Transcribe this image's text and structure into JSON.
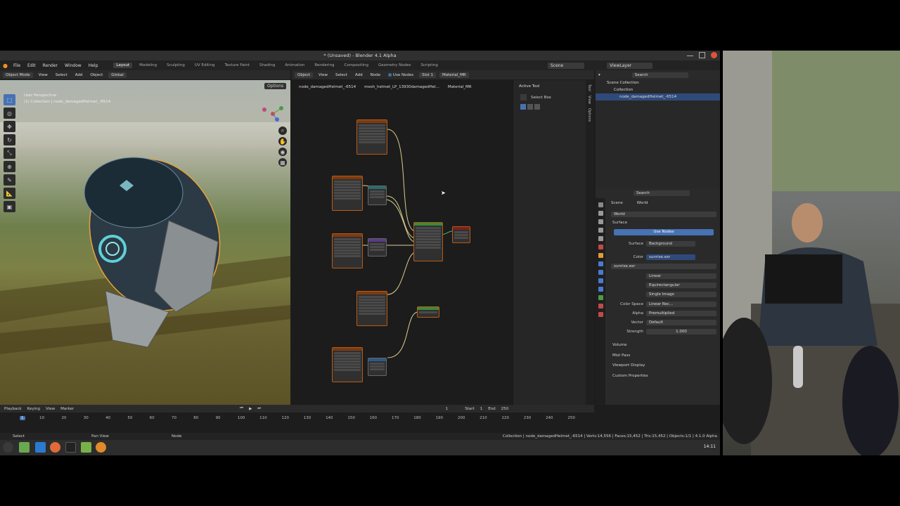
{
  "window": {
    "title": "* (Unsaved) - Blender 4.1 Alpha"
  },
  "menu": [
    "File",
    "Edit",
    "Render",
    "Window",
    "Help"
  ],
  "workspaces": [
    "Layout",
    "Modeling",
    "Sculpting",
    "UV Editing",
    "Texture Paint",
    "Shading",
    "Animation",
    "Rendering",
    "Compositing",
    "Geometry Nodes",
    "Scripting"
  ],
  "scene": {
    "label": "Scene",
    "viewlayer": "ViewLayer"
  },
  "viewport": {
    "mode": "Object Mode",
    "menus": [
      "View",
      "Select",
      "Add",
      "Object"
    ],
    "transform": "Global",
    "options": "Options",
    "info1": "User Perspective",
    "info2": "(1) Collection | node_damagedHelmet_-6514"
  },
  "node_editor": {
    "type": "Object",
    "menus": [
      "View",
      "Select",
      "Add",
      "Node"
    ],
    "use_nodes": "Use Nodes",
    "slot": "Slot 1",
    "material": "Material_MR",
    "breadcrumb": [
      "node_damagedHelmet_-6514",
      "mesh_helmet_LP_13930damagedHel...",
      "Material_MR"
    ]
  },
  "npanel": {
    "active_tool": "Active Tool",
    "select_box": "Select Box",
    "tabs": [
      "Tool",
      "View",
      "Options"
    ]
  },
  "outliner": {
    "search": "Search",
    "items": [
      "Scene Collection",
      "Collection",
      "node_damagedHelmet_-6514"
    ]
  },
  "properties": {
    "search": "Search",
    "scene": "Scene",
    "world_tab": "World",
    "world_name": "World",
    "surface_panel": "Surface",
    "use_nodes": "Use Nodes",
    "surface_label": "Surface",
    "surface_value": "Background",
    "color_label": "Color",
    "color_value": "sunrise.exr",
    "image": "sunrise.exr",
    "interp": "Linear",
    "projection": "Equirectangular",
    "source": "Single Image",
    "colorspace_label": "Color Space",
    "colorspace_value": "Linear Rec...",
    "alpha_label": "Alpha",
    "alpha_value": "Premultiplied",
    "vector_label": "Vector",
    "vector_value": "Default",
    "strength_label": "Strength",
    "strength_value": "1.000",
    "panels": [
      "Volume",
      "Mist Pass",
      "Viewport Display",
      "Custom Properties"
    ]
  },
  "timeline": {
    "menus": [
      "Playback",
      "Keying",
      "View",
      "Marker"
    ],
    "current": "1",
    "start_label": "Start",
    "start": "1",
    "end_label": "End",
    "end": "250",
    "ticks": [
      "1",
      "10",
      "20",
      "30",
      "40",
      "50",
      "60",
      "70",
      "80",
      "90",
      "100",
      "110",
      "120",
      "130",
      "140",
      "150",
      "160",
      "170",
      "180",
      "190",
      "200",
      "210",
      "220",
      "230",
      "240",
      "250"
    ]
  },
  "status": {
    "left": "Select",
    "mid": "Pan View",
    "node": "Node",
    "right": "Collection | node_damagedHelmet_-6514 | Verts:14,556 | Faces:15,452 | Tris:15,452 | Objects:1/1 | 4.1.0 Alpha"
  },
  "taskbar": {
    "clock": "14:11"
  },
  "colors": {
    "accent": "#4772b3",
    "node_border": "#b95b12",
    "bg": "#1d1d1d"
  }
}
